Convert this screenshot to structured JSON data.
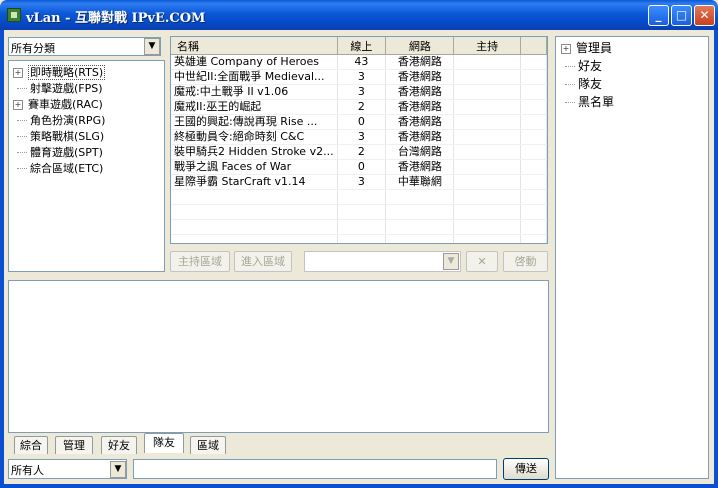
{
  "window": {
    "title": "vLan - 互聯對戰 IPvE.COM"
  },
  "category_select": {
    "value": "所有分類"
  },
  "game_tree": [
    {
      "label": "即時戰略(RTS)",
      "expandable": true,
      "selected": true
    },
    {
      "label": "射擊遊戲(FPS)",
      "expandable": false
    },
    {
      "label": "賽車遊戲(RAC)",
      "expandable": true
    },
    {
      "label": "角色扮演(RPG)",
      "expandable": false
    },
    {
      "label": "策略戰棋(SLG)",
      "expandable": false
    },
    {
      "label": "體育遊戲(SPT)",
      "expandable": false
    },
    {
      "label": "綜合區域(ETC)",
      "expandable": false
    }
  ],
  "room_table": {
    "headers": [
      "名稱",
      "線上",
      "網路",
      "主持"
    ],
    "rows": [
      [
        "英雄連 Company of Heroes",
        "43",
        "香港網路",
        ""
      ],
      [
        "中世紀II:全面戰爭 Medieval...",
        "3",
        "香港網路",
        ""
      ],
      [
        "魔戒:中土戰爭 II v1.06",
        "3",
        "香港網路",
        ""
      ],
      [
        "魔戒II:巫王的崛起",
        "2",
        "香港網路",
        ""
      ],
      [
        "王國的興起:傳說再現 Rise ...",
        "0",
        "香港網路",
        ""
      ],
      [
        "終極動員令:絕命時刻 C&C",
        "3",
        "香港網路",
        ""
      ],
      [
        "裝甲騎兵2 Hidden Stroke v2...",
        "2",
        "台灣網路",
        ""
      ],
      [
        "戰爭之諷 Faces of War",
        "0",
        "香港網路",
        ""
      ],
      [
        "星際爭霸 StarCraft v1.14",
        "3",
        "中華聯網",
        ""
      ]
    ]
  },
  "room_actions": {
    "host": "主持區域",
    "enter": "進入區域",
    "close": "✕",
    "start": "啓動"
  },
  "chat_tabs": [
    "綜合",
    "管理",
    "好友",
    "隊友",
    "區域"
  ],
  "active_tab": "隊友",
  "recipient_select": {
    "value": "所有人"
  },
  "send_button": "傳送",
  "contacts": [
    {
      "label": "管理員",
      "expandable": true
    },
    {
      "label": "好友",
      "expandable": false
    },
    {
      "label": "隊友",
      "expandable": false
    },
    {
      "label": "黑名單",
      "expandable": false
    }
  ],
  "colors": {
    "titlebar": "#0b58d8",
    "window_bg": "#ece9d8",
    "input_border": "#7f9db9"
  }
}
